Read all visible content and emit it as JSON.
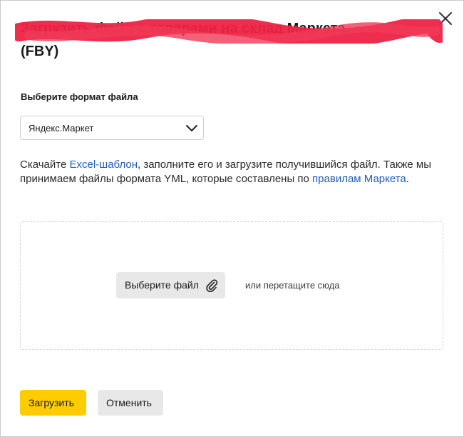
{
  "dialog": {
    "title_line1": "Загрузить файл с товарами на склад Маркета",
    "title_line2": "(FBY)",
    "redaction_color": "#ee2244",
    "close_icon": "close-icon"
  },
  "format": {
    "label": "Выберите формат файла",
    "selected": "Яндекс.Маркет",
    "chevron_icon": "chevron-down-icon"
  },
  "description": {
    "part1": "Скачайте ",
    "link1": "Excel-шаблон",
    "part2": ", заполните его и загрузите получившийся файл. Также мы принимаем файлы формата YML, которые составлены по ",
    "link2": "правилам Маркета",
    "part3": ".",
    "link_color": "#1f5fb8"
  },
  "dropzone": {
    "choose_label": "Выберите файл",
    "clip_icon": "paperclip-icon",
    "drag_hint": "или перетащите сюда"
  },
  "actions": {
    "upload_label": "Загрузить",
    "cancel_label": "Отменить",
    "upload_color": "#ffcc00"
  }
}
